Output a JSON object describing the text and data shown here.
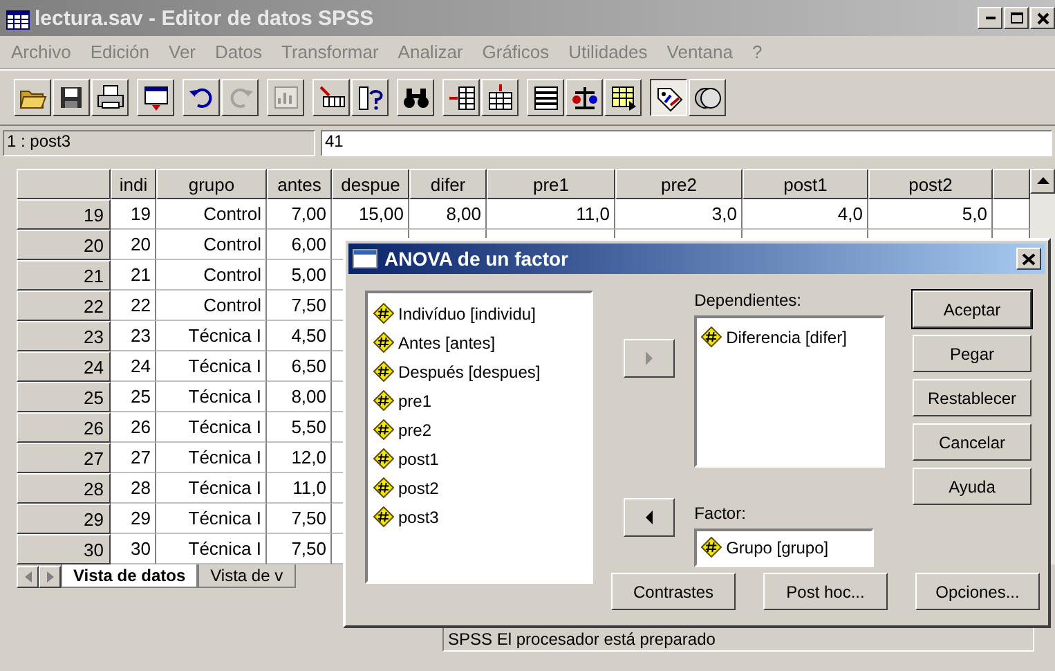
{
  "window": {
    "title": "lectura.sav - Editor de datos SPSS"
  },
  "menu": [
    "Archivo",
    "Edición",
    "Ver",
    "Datos",
    "Transformar",
    "Analizar",
    "Gráficos",
    "Utilidades",
    "Ventana",
    "?"
  ],
  "toolbar": [
    [
      {
        "kind": "open",
        "pressed": false,
        "disabled": false
      },
      {
        "kind": "save",
        "pressed": false,
        "disabled": false
      },
      {
        "kind": "print",
        "pressed": false,
        "disabled": false
      }
    ],
    [
      {
        "kind": "dialog",
        "pressed": false,
        "disabled": false
      }
    ],
    [
      {
        "kind": "undo",
        "pressed": false,
        "disabled": false
      },
      {
        "kind": "redo",
        "pressed": false,
        "disabled": true
      }
    ],
    [
      {
        "kind": "chart",
        "pressed": false,
        "disabled": true
      }
    ],
    [
      {
        "kind": "goto",
        "pressed": false,
        "disabled": false
      },
      {
        "kind": "variables",
        "pressed": false,
        "disabled": false
      }
    ],
    [
      {
        "kind": "find",
        "pressed": false,
        "disabled": false
      }
    ],
    [
      {
        "kind": "insertcase",
        "pressed": false,
        "disabled": false
      },
      {
        "kind": "insertvar",
        "pressed": false,
        "disabled": false
      }
    ],
    [
      {
        "kind": "split",
        "pressed": false,
        "disabled": false
      },
      {
        "kind": "weight",
        "pressed": false,
        "disabled": false
      },
      {
        "kind": "select",
        "pressed": false,
        "disabled": false
      }
    ],
    [
      {
        "kind": "labels",
        "pressed": true,
        "disabled": false
      },
      {
        "kind": "sets",
        "pressed": false,
        "disabled": false
      }
    ]
  ],
  "cell_editor": {
    "cell": "1 : post3",
    "value": "41"
  },
  "grid": {
    "columns": [
      "indi",
      "grupo",
      "antes",
      "despue",
      "difer",
      "pre1",
      "pre2",
      "post1",
      "post2"
    ],
    "rows": [
      {
        "case": "19",
        "cells": [
          "19",
          "Control",
          "7,00",
          "15,00",
          "8,00",
          "11,0",
          "3,0",
          "4,0",
          "5,0"
        ]
      },
      {
        "case": "20",
        "cells": [
          "20",
          "Control",
          "6,00"
        ]
      },
      {
        "case": "21",
        "cells": [
          "21",
          "Control",
          "5,00"
        ]
      },
      {
        "case": "22",
        "cells": [
          "22",
          "Control",
          "7,50"
        ]
      },
      {
        "case": "23",
        "cells": [
          "23",
          "Técnica I",
          "4,50"
        ]
      },
      {
        "case": "24",
        "cells": [
          "24",
          "Técnica I",
          "6,50"
        ]
      },
      {
        "case": "25",
        "cells": [
          "25",
          "Técnica I",
          "8,00"
        ]
      },
      {
        "case": "26",
        "cells": [
          "26",
          "Técnica I",
          "5,50"
        ]
      },
      {
        "case": "27",
        "cells": [
          "27",
          "Técnica I",
          "12,0"
        ]
      },
      {
        "case": "28",
        "cells": [
          "28",
          "Técnica I",
          "11,0"
        ]
      },
      {
        "case": "29",
        "cells": [
          "29",
          "Técnica I",
          "7,50"
        ]
      },
      {
        "case": "30",
        "cells": [
          "30",
          "Técnica I",
          "7,50"
        ]
      }
    ]
  },
  "sheet_tabs": [
    {
      "label": "Vista de datos",
      "selected": true
    },
    {
      "label": "Vista de v",
      "selected": false
    }
  ],
  "status_bar": "SPSS El procesador  está preparado",
  "dialog": {
    "title": "ANOVA de un factor",
    "variables": [
      "Indivíduo [individu]",
      "Antes [antes]",
      "Después [despues]",
      "pre1",
      "pre2",
      "post1",
      "post2",
      "post3"
    ],
    "dependents_label": "Dependientes:",
    "dependents": [
      "Diferencia [difer]"
    ],
    "move_dependents": {
      "disabled": true
    },
    "move_factor": {
      "disabled": false
    },
    "factor_label": "Factor:",
    "factor": "Grupo [grupo]",
    "side_buttons": [
      {
        "label": "Aceptar",
        "default": true
      },
      {
        "label": "Pegar",
        "default": false
      },
      {
        "label": "Restablecer",
        "default": false
      },
      {
        "label": "Cancelar",
        "default": false
      },
      {
        "label": "Ayuda",
        "default": false
      }
    ],
    "bottom_buttons": [
      "Contrastes",
      "Post hoc...",
      "Opciones..."
    ]
  }
}
